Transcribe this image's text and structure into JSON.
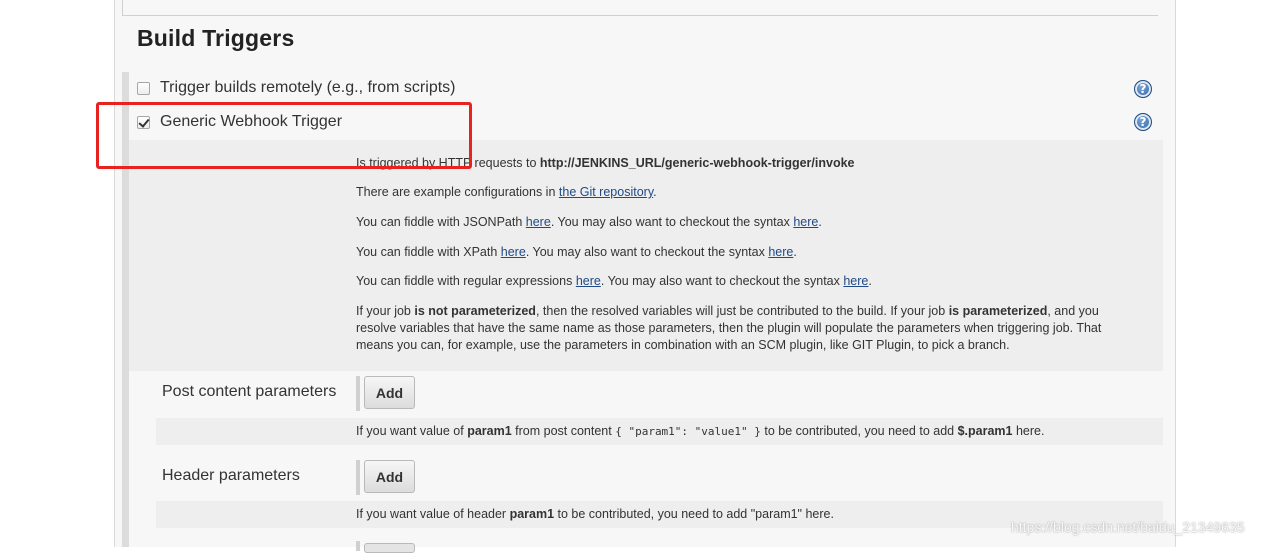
{
  "section": {
    "title": "Build Triggers"
  },
  "triggers": [
    {
      "label": "Trigger builds remotely (e.g., from scripts)",
      "checked": false
    },
    {
      "label": "Generic Webhook Trigger",
      "checked": true
    }
  ],
  "help": {
    "line1_prefix": "Is triggered by HTTP requests to ",
    "line1_url": "http://JENKINS_URL/generic-webhook-trigger/invoke",
    "line2_prefix": "There are example configurations in ",
    "line2_link": "the Git repository",
    "line2_suffix": ".",
    "line3_prefix": "You can fiddle with JSONPath ",
    "line3_link1": "here",
    "line3_mid": ". You may also want to checkout the syntax ",
    "line3_link2": "here",
    "line3_suffix": ".",
    "line4_prefix": "You can fiddle with XPath ",
    "line4_link1": "here",
    "line4_mid": ". You may also want to checkout the syntax ",
    "line4_link2": "here",
    "line4_suffix": ".",
    "line5_prefix": "You can fiddle with regular expressions ",
    "line5_link1": "here",
    "line5_mid": ". You may also want to checkout the syntax ",
    "line5_link2": "here",
    "line5_suffix": ".",
    "para_a": "If your job ",
    "para_b": "is not parameterized",
    "para_c": ", then the resolved variables will just be contributed to the build. If your job ",
    "para_d": "is parameterized",
    "para_e": ", and you resolve variables that have the same name as those parameters, then the plugin will populate the parameters when triggering job. That means you can, for example, use the parameters in combination with an SCM plugin, like GIT Plugin, to pick a branch."
  },
  "post_content": {
    "label": "Post content parameters",
    "add_label": "Add",
    "hint_a": "If you want value of ",
    "hint_b": "param1",
    "hint_c": " from post content ",
    "hint_code": "{ \"param1\": \"value1\" }",
    "hint_d": " to be contributed, you need to add ",
    "hint_e": "$.param1",
    "hint_f": " here."
  },
  "header_params": {
    "label": "Header parameters",
    "add_label": "Add",
    "hint_a": "If you want value of header ",
    "hint_b": "param1",
    "hint_c": " to be contributed, you need to add \"param1\" here."
  },
  "watermark": "https://blog.csdn.net/baidu_21349635",
  "icons": {
    "help": "help-icon",
    "checkbox": "checkbox-icon"
  },
  "colors": {
    "highlight": "#e8231f",
    "link": "#204a87"
  }
}
